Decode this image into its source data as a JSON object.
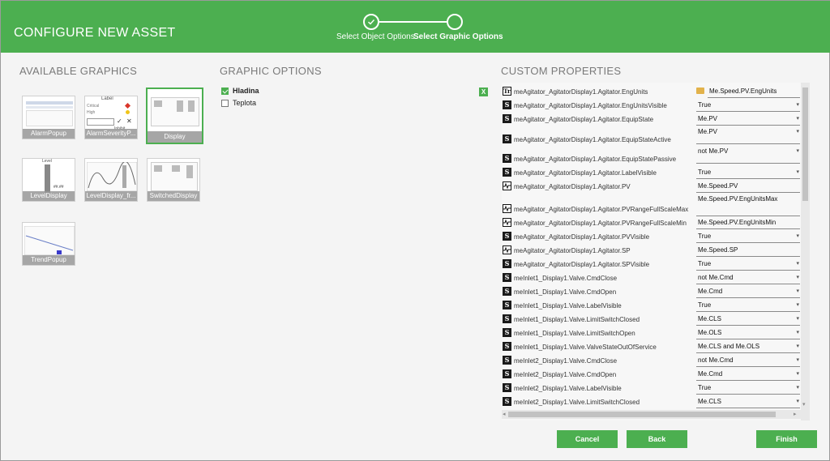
{
  "header": {
    "title": "CONFIGURE NEW ASSET",
    "steps": [
      {
        "label": "Select Object Options",
        "status": "done"
      },
      {
        "label": "Select Graphic Options",
        "status": "current"
      }
    ]
  },
  "available_graphics": {
    "title": "AVAILABLE GRAPHICS",
    "items": [
      {
        "label": "AlarmPopup",
        "selected": false
      },
      {
        "label": "AlarmSeverityP...",
        "selected": false
      },
      {
        "label": "Display",
        "selected": true
      },
      {
        "label": "LevelDisplay",
        "selected": false
      },
      {
        "label": "LevelDisplay_fr...",
        "selected": false
      },
      {
        "label": "SwitchedDisplay",
        "selected": false
      },
      {
        "label": "TrendPopup",
        "selected": false
      }
    ],
    "thumb_text": {
      "label": "Label",
      "critical": "Critical",
      "high": "High",
      "inhibit": "Inhibit",
      "level": "Level",
      "level_value": "##.##"
    }
  },
  "graphic_options": {
    "title": "GRAPHIC OPTIONS",
    "options": [
      {
        "label": "Hladina",
        "checked": true
      },
      {
        "label": "Teplota",
        "checked": false
      }
    ],
    "excel_icon": "X"
  },
  "custom_properties": {
    "title": "CUSTOM PROPERTIES",
    "rows": [
      {
        "icon": "T",
        "name": "meAgitator_AgitatorDisplay1.Agitator.EngUnits",
        "value": "Me.Speed.PV.EngUnits",
        "dropdown": false
      },
      {
        "icon": "S",
        "name": "meAgitator_AgitatorDisplay1.Agitator.EngUnitsVisible",
        "value": "True",
        "dropdown": true
      },
      {
        "icon": "S",
        "name": "meAgitator_AgitatorDisplay1.Agitator.EquipState",
        "value": "Me.PV",
        "dropdown": true
      },
      {
        "icon": "S",
        "name": "meAgitator_AgitatorDisplay1.Agitator.EquipStateActive",
        "value": "Me.PV",
        "dropdown": true
      },
      {
        "icon": "S",
        "name": "meAgitator_AgitatorDisplay1.Agitator.EquipStatePassive",
        "value": "not Me.PV",
        "dropdown": true
      },
      {
        "icon": "S",
        "name": "meAgitator_AgitatorDisplay1.Agitator.LabelVisible",
        "value": "True",
        "dropdown": true
      },
      {
        "icon": "W",
        "name": "meAgitator_AgitatorDisplay1.Agitator.PV",
        "value": "Me.Speed.PV",
        "dropdown": false
      },
      {
        "icon": "W",
        "name": "meAgitator_AgitatorDisplay1.Agitator.PVRangeFullScaleMax",
        "value": "Me.Speed.PV.EngUnitsMax",
        "dropdown": false
      },
      {
        "icon": "W",
        "name": "meAgitator_AgitatorDisplay1.Agitator.PVRangeFullScaleMin",
        "value": "Me.Speed.PV.EngUnitsMin",
        "dropdown": false
      },
      {
        "icon": "S",
        "name": "meAgitator_AgitatorDisplay1.Agitator.PVVisible",
        "value": "True",
        "dropdown": true
      },
      {
        "icon": "W",
        "name": "meAgitator_AgitatorDisplay1.Agitator.SP",
        "value": "Me.Speed.SP",
        "dropdown": false
      },
      {
        "icon": "S",
        "name": "meAgitator_AgitatorDisplay1.Agitator.SPVisible",
        "value": "True",
        "dropdown": true
      },
      {
        "icon": "S",
        "name": "meInlet1_Display1.Valve.CmdClose",
        "value": "not Me.Cmd",
        "dropdown": true
      },
      {
        "icon": "S",
        "name": "meInlet1_Display1.Valve.CmdOpen",
        "value": "Me.Cmd",
        "dropdown": true
      },
      {
        "icon": "S",
        "name": "meInlet1_Display1.Valve.LabelVisible",
        "value": "True",
        "dropdown": true
      },
      {
        "icon": "S",
        "name": "meInlet1_Display1.Valve.LimitSwitchClosed",
        "value": "Me.CLS",
        "dropdown": true
      },
      {
        "icon": "S",
        "name": "meInlet1_Display1.Valve.LimitSwitchOpen",
        "value": "Me.OLS",
        "dropdown": true
      },
      {
        "icon": "S",
        "name": "meInlet1_Display1.Valve.ValveStateOutOfService",
        "value": "Me.CLS and Me.OLS",
        "dropdown": true
      },
      {
        "icon": "S",
        "name": "meInlet2_Display1.Valve.CmdClose",
        "value": "not Me.Cmd",
        "dropdown": true
      },
      {
        "icon": "S",
        "name": "meInlet2_Display1.Valve.CmdOpen",
        "value": "Me.Cmd",
        "dropdown": true
      },
      {
        "icon": "S",
        "name": "meInlet2_Display1.Valve.LabelVisible",
        "value": "True",
        "dropdown": true
      },
      {
        "icon": "S",
        "name": "meInlet2_Display1.Valve.LimitSwitchClosed",
        "value": "Me.CLS",
        "dropdown": true
      }
    ]
  },
  "buttons": {
    "cancel": "Cancel",
    "back": "Back",
    "finish": "Finish"
  },
  "colors": {
    "accent": "#4caf50",
    "background": "#f4f4f4"
  }
}
